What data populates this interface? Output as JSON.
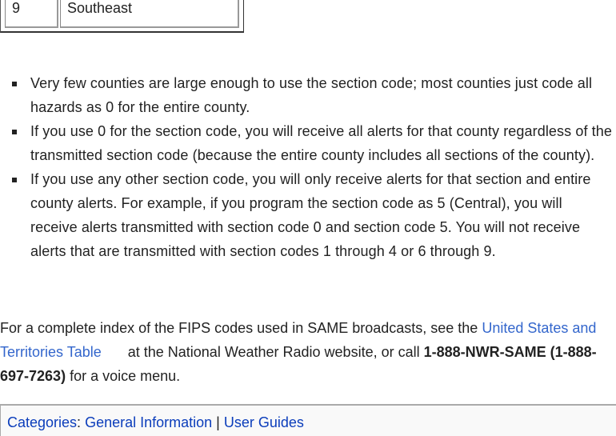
{
  "table": {
    "rows": [
      {
        "code": "9",
        "region": "Southeast"
      }
    ]
  },
  "notes": [
    "Very few counties are large enough to use the section code; most counties just code all hazards as 0 for the entire county.",
    "If you use 0 for the section code, you will receive all alerts for that county regardless of the transmitted section code (because the entire county includes all sections of the county).",
    "If you use any other section code, you will only receive alerts for that section and entire county alerts. For example, if you program the section code as 5 (Central), you will receive alerts transmitted with section code 0 and section code 5. You will not receive alerts that are transmitted with section codes 1 through 4 or 6 through 9."
  ],
  "paragraph": {
    "before_link": "For a complete index of the FIPS codes used in SAME broadcasts, see the ",
    "link_text": "United States and Territories Table",
    "after_link": " at the National Weather Radio website, or call ",
    "phone_bold": "1-888-NWR-SAME (1-888-697-7263)",
    "tail": " for a voice menu."
  },
  "categories": {
    "label": "Categories",
    "colon": ": ",
    "items": [
      "General Information",
      "User Guides"
    ],
    "separator": " | "
  },
  "colors": {
    "link": "#3366cc",
    "category_link": "#0b3dbb",
    "footer_bg": "#f9f9f9",
    "text": "#222222"
  }
}
